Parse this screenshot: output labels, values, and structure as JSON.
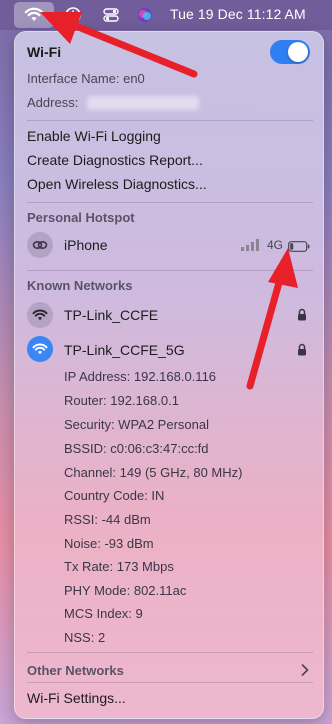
{
  "menubar": {
    "date_time": "Tue 19 Dec  11:12 AM"
  },
  "wifi": {
    "title": "Wi-Fi",
    "toggle_on": true,
    "interface_label": "Interface Name: en0",
    "address_label": "Address:",
    "address_value": "",
    "menu": [
      "Enable Wi-Fi Logging",
      "Create Diagnostics Report...",
      "Open Wireless Diagnostics..."
    ]
  },
  "hotspot": {
    "section": "Personal Hotspot",
    "device": "iPhone",
    "network_type": "4G"
  },
  "known": {
    "section": "Known Networks",
    "networks": [
      {
        "name": "TP-Link_CCFE",
        "active": false,
        "locked": true
      },
      {
        "name": "TP-Link_CCFE_5G",
        "active": true,
        "locked": true
      }
    ],
    "details": [
      "IP Address: 192.168.0.116",
      "Router: 192.168.0.1",
      "Security: WPA2 Personal",
      "BSSID: c0:06:c3:47:cc:fd",
      "Channel: 149 (5 GHz, 80 MHz)",
      "Country Code: IN",
      "RSSI: -44 dBm",
      "Noise: -93 dBm",
      "Tx Rate: 173 Mbps",
      "PHY Mode: 802.11ac",
      "MCS Index: 9",
      "NSS: 2"
    ]
  },
  "other_networks": "Other Networks",
  "settings": "Wi-Fi Settings...",
  "colors": {
    "accent": "#2f7ff3",
    "arrow": "#e8202a",
    "active_network": "#3a86f5"
  }
}
